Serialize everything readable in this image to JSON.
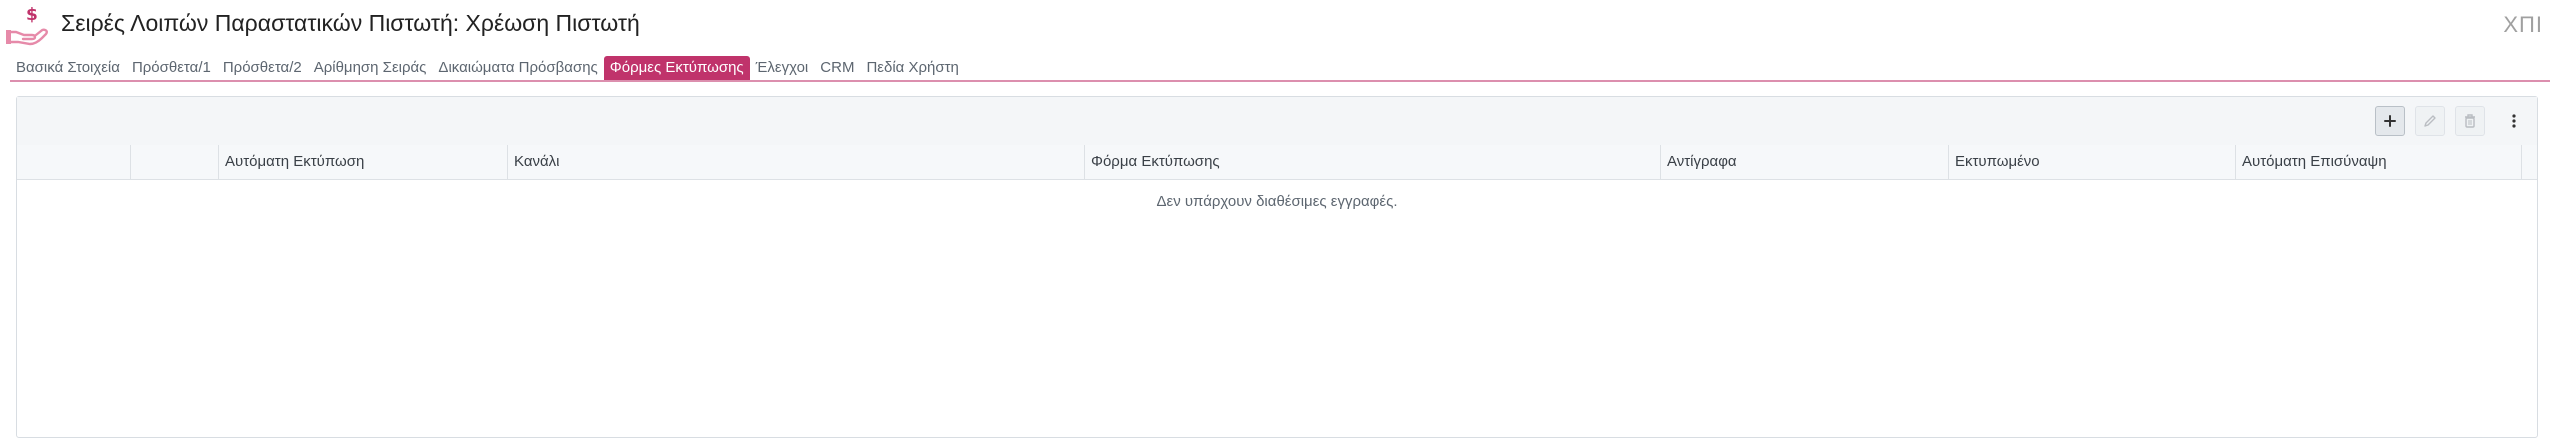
{
  "header": {
    "title": "Σειρές Λοιπών Παραστατικών Πιστωτή: Χρέωση Πιστωτή",
    "corner_code": "ΧΠΙ",
    "icon": "money-hand-icon"
  },
  "tabs": [
    {
      "label": "Βασικά Στοιχεία",
      "active": false
    },
    {
      "label": "Πρόσθετα/1",
      "active": false
    },
    {
      "label": "Πρόσθετα/2",
      "active": false
    },
    {
      "label": "Αρίθμηση Σειράς",
      "active": false
    },
    {
      "label": "Δικαιώματα Πρόσβασης",
      "active": false
    },
    {
      "label": "Φόρμες Εκτύπωσης",
      "active": true
    },
    {
      "label": "Έλεγχοι",
      "active": false
    },
    {
      "label": "CRM",
      "active": false
    },
    {
      "label": "Πεδία Χρήστη",
      "active": false
    }
  ],
  "toolbar": {
    "add_icon": "plus-icon",
    "edit_icon": "pencil-icon",
    "delete_icon": "trash-icon",
    "more_icon": "vertical-dots-icon"
  },
  "grid": {
    "columns": [
      "",
      "",
      "Αυτόματη Εκτύπωση",
      "Κανάλι",
      "Φόρμα Εκτύπωσης",
      "Αντίγραφα",
      "Εκτυπωμένο",
      "Αυτόματη Επισύναψη"
    ],
    "empty_message": "Δεν υπάρχουν διαθέσιμες εγγραφές."
  },
  "colors": {
    "accent": "#c0336b",
    "icon_pink": "#e68aa9"
  }
}
